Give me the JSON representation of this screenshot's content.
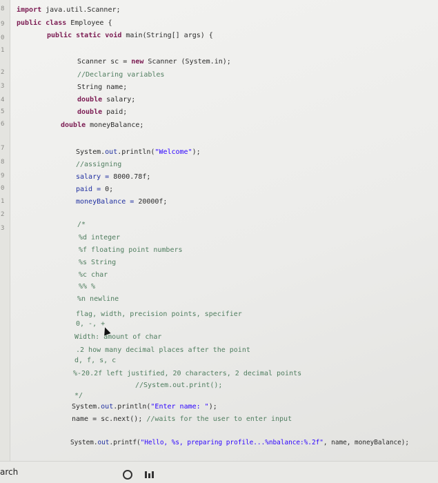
{
  "gutter_numbers": [
    "8",
    "9",
    "0",
    "1",
    "2",
    "3",
    "4",
    "5",
    "6",
    "7",
    "8",
    "9",
    "0",
    "1",
    "2",
    "3"
  ],
  "code": {
    "l1_kw": "import",
    "l1_rest": " java.util.Scanner;",
    "l2_kw": "public class",
    "l2_rest": " Employee {",
    "l3_kw": "public static void",
    "l3_rest": " main(String[] args) {",
    "l4": "Scanner sc = ",
    "l4_kw": "new",
    "l4_rest": " Scanner (System.in);",
    "l5": "//Declaring variables",
    "l6": "String name;",
    "l7_kw": "double",
    "l7_rest": " salary;",
    "l8_kw": "double",
    "l8_rest": " paid;",
    "l9_kw": "double",
    "l9_rest": " moneyBalance;",
    "l10_a": "System.",
    "l10_b": "out",
    "l10_c": ".println(",
    "l10_str": "\"Welcome\"",
    "l10_d": ");",
    "l11": "//assigning",
    "l12_a": "salary = ",
    "l12_b": "8000.78f;",
    "l13_a": "paid = ",
    "l13_b": "0;",
    "l14_a": "moneyBalance = ",
    "l14_b": "20000f;",
    "l15": "/*",
    "l16": "%d integer",
    "l17": "%f floating point numbers",
    "l18": "%s String",
    "l19": "%c char",
    "l20": "%% %",
    "l21": "%n newline",
    "l22": "flag, width, precision points, specifier",
    "l23": "0, -, +",
    "l24": "Width: amount of char",
    "l25": ".2 how many decimal places after the point",
    "l26": "d, f, s, c",
    "l27": "%-20.2f  left justified, 20 characters, 2 decimal points",
    "l28": "//System.out.print();",
    "l29": "*/",
    "l30_a": "System.",
    "l30_b": "out",
    "l30_c": ".println(",
    "l30_str": "\"Enter name: \"",
    "l30_d": ");",
    "l31_a": "name = sc.next(); ",
    "l31_cmt": "//waits for the user to enter input",
    "l32_a": "System.",
    "l32_b": "out",
    "l32_c": ".printf(",
    "l32_str": "\"Hello, %s, preparing profile...%nbalance:%.2f\"",
    "l32_d": ", name, moneyBalance);"
  },
  "taskbar": {
    "search_label": "arch"
  },
  "colors": {
    "keyword": "#7b1b52",
    "string": "#2a00ff",
    "comment": "#4f7d5f",
    "field": "#1f2fa0"
  }
}
